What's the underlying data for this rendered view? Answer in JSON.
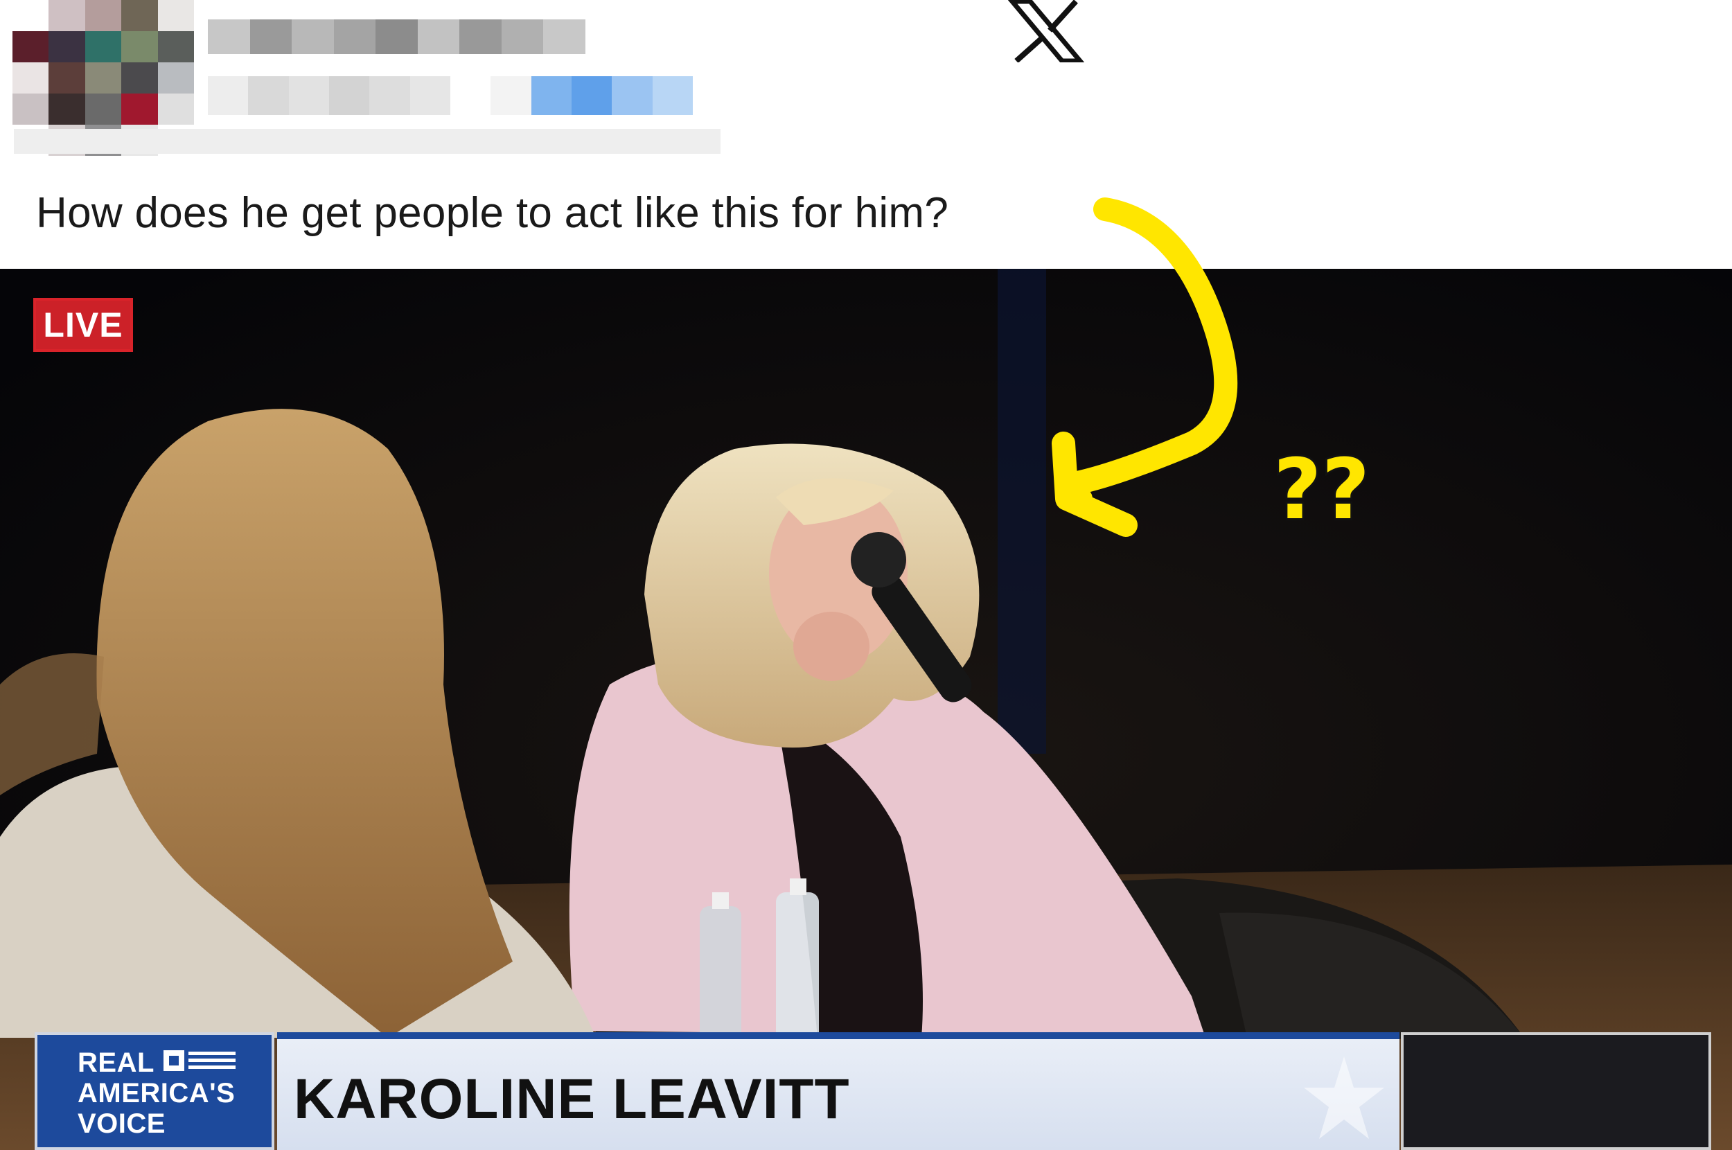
{
  "tweet": {
    "text": "How does he get people to act like this for him?",
    "platform_icon": "x-logo-icon"
  },
  "annotation": {
    "question_marks": "??",
    "color": "#ffe600"
  },
  "video": {
    "live_label": "LIVE",
    "brand_lines": [
      "REAL",
      "AMERICA'S",
      "VOICE"
    ],
    "lower_third_name": "KAROLINE LEAVITT",
    "brand_color": "#1d4a9c",
    "live_color": "#cc2128"
  }
}
